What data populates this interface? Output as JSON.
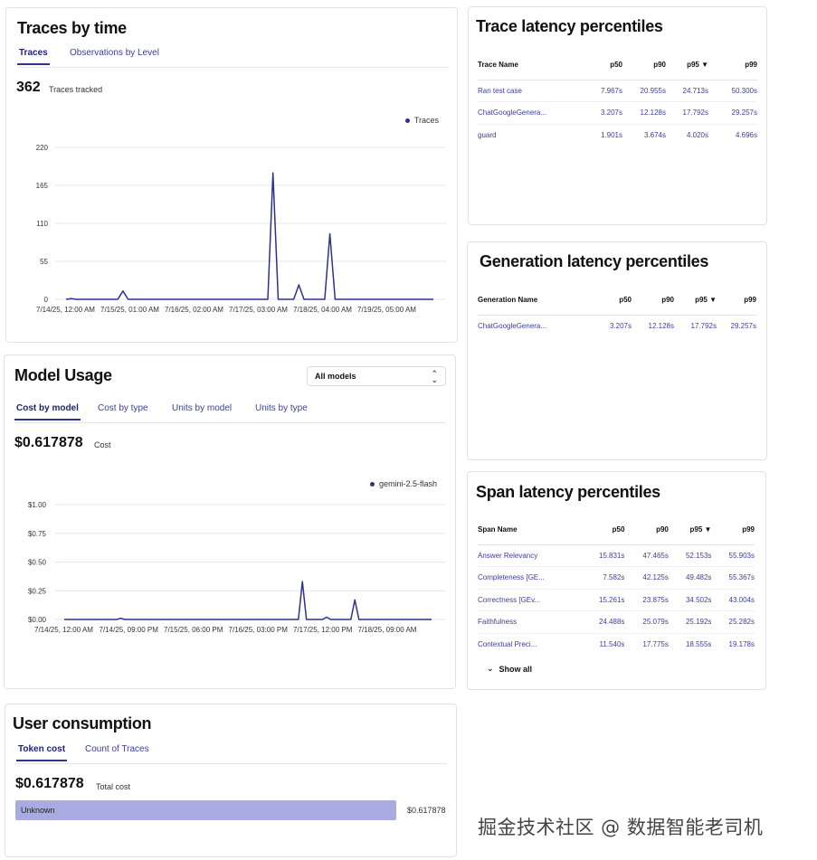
{
  "traces_by_time": {
    "title": "Traces by time",
    "tabs": [
      "Traces",
      "Observations by Level"
    ],
    "total": "362",
    "total_label": "Traces tracked",
    "legend": "Traces"
  },
  "model_usage": {
    "title": "Model Usage",
    "select_value": "All models",
    "tabs": [
      "Cost by model",
      "Cost by type",
      "Units by model",
      "Units by type"
    ],
    "total": "$0.617878",
    "total_label": "Cost",
    "legend": "gemini-2.5-flash"
  },
  "user_consumption": {
    "title": "User consumption",
    "tabs": [
      "Token cost",
      "Count of Traces"
    ],
    "total": "$0.617878",
    "total_label": "Total cost",
    "bar": {
      "label": "Unknown",
      "value": "$0.617878",
      "fraction": 1.0
    }
  },
  "trace_latency": {
    "title": "Trace latency percentiles",
    "headers": [
      "Trace Name",
      "p50",
      "p90",
      "p95 ▼",
      "p99"
    ],
    "rows": [
      [
        "Ran test case",
        "7.967s",
        "20.955s",
        "24.713s",
        "50.300s"
      ],
      [
        "ChatGoogleGenera...",
        "3.207s",
        "12.128s",
        "17.792s",
        "29.257s"
      ],
      [
        "guard",
        "1.901s",
        "3.674s",
        "4.020s",
        "4.696s"
      ]
    ]
  },
  "generation_latency": {
    "title": "Generation latency percentiles",
    "headers": [
      "Generation Name",
      "p50",
      "p90",
      "p95 ▼",
      "p99"
    ],
    "rows": [
      [
        "ChatGoogleGenera...",
        "3.207s",
        "12.128s",
        "17.792s",
        "29.257s"
      ]
    ]
  },
  "span_latency": {
    "title": "Span latency percentiles",
    "headers": [
      "Span Name",
      "p50",
      "p90",
      "p95 ▼",
      "p99"
    ],
    "rows": [
      [
        "Answer Relevancy",
        "15.831s",
        "47.465s",
        "52.153s",
        "55.903s"
      ],
      [
        "Completeness [GE...",
        "7.582s",
        "42.125s",
        "49.482s",
        "55.367s"
      ],
      [
        "Correctness [GEv...",
        "15.261s",
        "23.875s",
        "34.502s",
        "43.004s"
      ],
      [
        "Faithfulness",
        "24.488s",
        "25.079s",
        "25.192s",
        "25.282s"
      ],
      [
        "Contextual Preci...",
        "11.540s",
        "17.775s",
        "18.555s",
        "19.178s"
      ]
    ],
    "show_all": "Show all"
  },
  "watermark": "掘金技术社区 @ 数据智能老司机",
  "colors": {
    "line": "#2e3190",
    "bar": "#a9aadf",
    "accent": "#30348c"
  },
  "chart_data": [
    {
      "type": "line",
      "title": "",
      "series": [
        {
          "name": "Traces",
          "values": [
            0,
            1,
            0,
            0,
            0,
            0,
            0,
            0,
            0,
            0,
            0,
            12,
            0,
            0,
            0,
            0,
            0,
            0,
            0,
            0,
            0,
            0,
            0,
            0,
            0,
            0,
            0,
            0,
            0,
            0,
            0,
            0,
            0,
            0,
            0,
            0,
            0,
            0,
            0,
            0,
            183,
            0,
            0,
            0,
            0,
            21,
            0,
            0,
            0,
            0,
            0,
            95,
            0,
            0,
            0,
            0,
            0,
            0,
            0,
            0,
            0,
            0,
            0,
            0,
            0,
            0,
            0,
            0,
            0,
            0,
            0,
            0
          ]
        }
      ],
      "x_ticks": [
        "7/14/25, 12:00 AM",
        "7/15/25, 01:00 AM",
        "7/16/25, 02:00 AM",
        "7/17/25, 03:00 AM",
        "7/18/25, 04:00 AM",
        "7/19/25, 05:00 AM"
      ],
      "y_ticks": [
        "0",
        "55",
        "110",
        "165",
        "220"
      ],
      "ylim": [
        0,
        220
      ],
      "grid": true,
      "legend": "top-right"
    },
    {
      "type": "line",
      "title": "",
      "series": [
        {
          "name": "gemini-2.5-flash",
          "values": [
            0,
            0,
            0,
            0,
            0,
            0,
            0,
            0,
            0,
            0,
            0,
            0,
            0,
            0,
            0.01,
            0,
            0,
            0,
            0,
            0,
            0,
            0,
            0,
            0,
            0,
            0,
            0,
            0,
            0,
            0,
            0,
            0,
            0,
            0,
            0,
            0,
            0,
            0,
            0,
            0,
            0,
            0,
            0,
            0,
            0,
            0,
            0,
            0,
            0,
            0,
            0,
            0,
            0,
            0,
            0,
            0,
            0,
            0,
            0,
            0.33,
            0,
            0,
            0,
            0,
            0,
            0.02,
            0,
            0,
            0,
            0,
            0,
            0,
            0.17,
            0,
            0,
            0,
            0,
            0,
            0,
            0,
            0,
            0,
            0,
            0,
            0,
            0,
            0,
            0,
            0,
            0,
            0,
            0
          ]
        }
      ],
      "x_ticks": [
        "7/14/25, 12:00 AM",
        "7/14/25, 09:00 PM",
        "7/15/25, 06:00 PM",
        "7/16/25, 03:00 PM",
        "7/17/25, 12:00 PM",
        "7/18/25, 09:00 AM"
      ],
      "y_ticks": [
        "$0.00",
        "$0.25",
        "$0.50",
        "$0.75",
        "$1.00"
      ],
      "ylim": [
        0,
        1
      ],
      "grid": true,
      "legend": "top-right"
    }
  ]
}
